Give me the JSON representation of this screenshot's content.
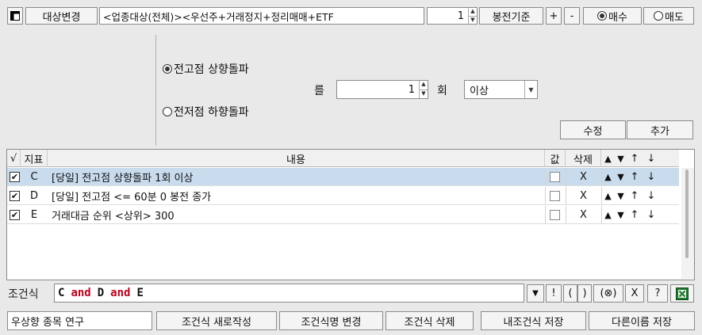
{
  "toolbar": {
    "mode_button": "대상변경",
    "target_text": "<업종대상(전체)><우선주+거래정지+정리매매+ETF",
    "count_value": "1",
    "basis_button": "봉전기준",
    "plus_button": "+",
    "minus_button": "-",
    "buy_label": "매수",
    "sell_label": "매도",
    "buy_selected": true
  },
  "condition_editor": {
    "option_high": "전고점 상향돌파",
    "option_low": "전저점 하향돌파",
    "high_selected": true,
    "particle": "를",
    "times_value": "1",
    "times_unit": "회",
    "compare_select": "이상",
    "edit_button": "수정",
    "add_button": "추가"
  },
  "grid": {
    "headers": {
      "check": "√",
      "indicator": "지표",
      "content": "내용",
      "value": "값",
      "delete": "삭제",
      "move_up": "▲",
      "move_down": "▼",
      "top": "↑",
      "bottom": "↓"
    },
    "rows": [
      {
        "checked": true,
        "indicator": "C",
        "content": "[당일] 전고점 상향돌파 1회 이상",
        "delete": "X",
        "up": "▲",
        "down": "▼",
        "top": "↑",
        "bottom": "↓",
        "selected": true
      },
      {
        "checked": true,
        "indicator": "D",
        "content": "[당일] 전고점 <= 60분 0 봉전 종가",
        "delete": "X",
        "up": "▲",
        "down": "▼",
        "top": "↑",
        "bottom": "↓",
        "selected": false
      },
      {
        "checked": true,
        "indicator": "E",
        "content": "거래대금 순위 <상위> 300",
        "delete": "X",
        "up": "▲",
        "down": "▼",
        "top": "↑",
        "bottom": "↓",
        "selected": false
      }
    ]
  },
  "formula": {
    "label": "조건식",
    "tokens": [
      "C",
      "and",
      "D",
      "and",
      "E"
    ],
    "tools": [
      "▼",
      "!",
      "(",
      ")",
      "(⊗)",
      "X",
      "?"
    ]
  },
  "bottom_bar": {
    "name_value": "우상향 종목 연구",
    "new_button": "조건식 새로작성",
    "rename_button": "조건식명 변경",
    "delete_button": "조건식 삭제",
    "save_button": "내조건식 저장",
    "save_as_button": "다른이름 저장"
  },
  "colors": {
    "operator": "#c0001a",
    "selection": "#c9dced",
    "excel_icon": "#1d7a2e"
  }
}
